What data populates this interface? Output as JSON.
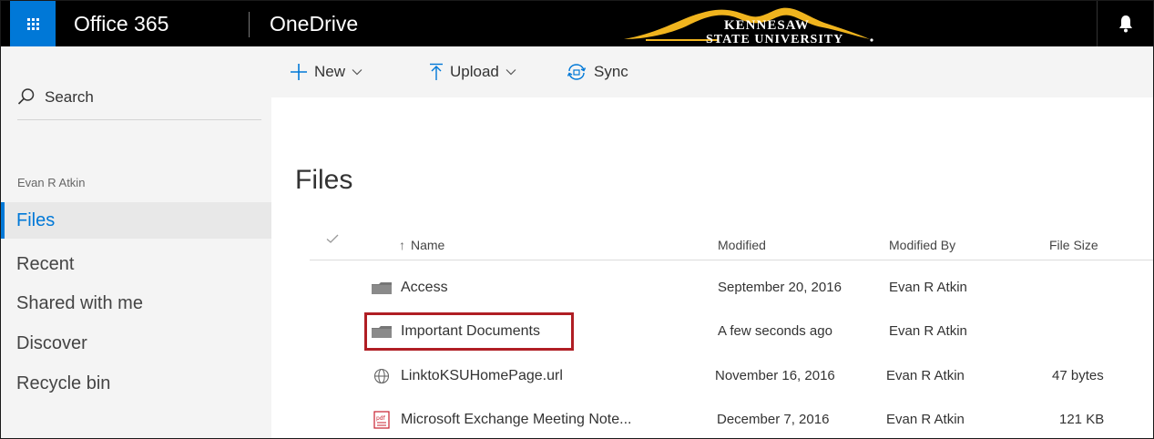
{
  "topbar": {
    "app_name": "Office 365",
    "service_name": "OneDrive",
    "logo_line1": "KENNESAW",
    "logo_line2": "STATE UNIVERSITY"
  },
  "leftnav": {
    "search_label": "Search",
    "user_name": "Evan R Atkin",
    "items": [
      {
        "label": "Files",
        "active": true
      },
      {
        "label": "Recent"
      },
      {
        "label": "Shared with me"
      },
      {
        "label": "Discover"
      },
      {
        "label": "Recycle bin"
      }
    ]
  },
  "commands": {
    "new_label": "New",
    "upload_label": "Upload",
    "sync_label": "Sync"
  },
  "main": {
    "title": "Files",
    "columns": {
      "name": "Name",
      "modified": "Modified",
      "modified_by": "Modified By",
      "file_size": "File Size"
    },
    "rows": [
      {
        "icon": "folder-icon",
        "name": "Access",
        "modified": "September 20, 2016",
        "modified_by": "Evan R Atkin",
        "size": ""
      },
      {
        "icon": "folder-icon",
        "name": "Important Documents",
        "modified": "A few seconds ago",
        "modified_by": "Evan R Atkin",
        "size": ""
      },
      {
        "icon": "globe-icon",
        "name": "LinktoKSUHomePage.url",
        "modified": "November 16, 2016",
        "modified_by": "Evan R Atkin",
        "size": "47 bytes"
      },
      {
        "icon": "pdf-icon",
        "name": "Microsoft Exchange Meeting Note...",
        "modified": "December 7, 2016",
        "modified_by": "Evan R Atkin",
        "size": "121 KB"
      }
    ]
  },
  "colors": {
    "accent": "#0078d7",
    "topbar": "#000000",
    "highlight_box": "#b01e24",
    "logo_gold": "#f0b41e"
  }
}
